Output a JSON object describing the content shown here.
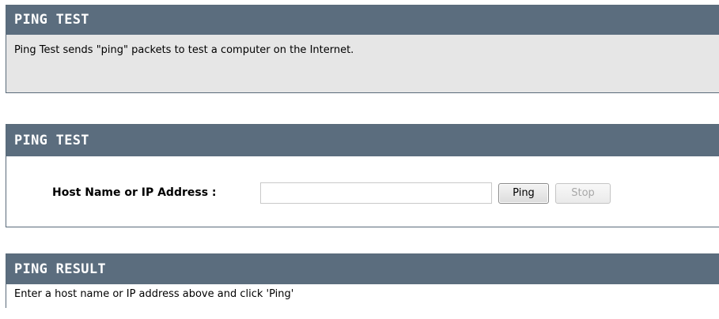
{
  "info_section": {
    "title": "PING TEST",
    "description": "Ping Test sends \"ping\" packets to test a computer on the Internet."
  },
  "ping_section": {
    "title": "PING TEST",
    "host_label": "Host Name or IP Address :",
    "host_value": "",
    "host_placeholder": "",
    "ping_button": "Ping",
    "stop_button": "Stop",
    "stop_enabled": false
  },
  "result_section": {
    "title": "PING RESULT",
    "message": "Enter a host name or IP address above and click 'Ping'"
  },
  "colors": {
    "header_bg": "#5b6d7e",
    "header_text": "#ffffff",
    "description_bg": "#e6e6e6"
  }
}
